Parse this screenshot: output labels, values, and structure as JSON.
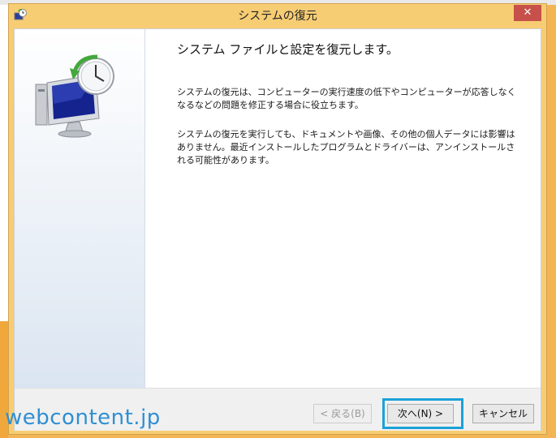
{
  "window": {
    "title": "システムの復元",
    "close_label": "✕"
  },
  "content": {
    "heading": "システム ファイルと設定を復元します。",
    "paragraph1": "システムの復元は、コンピューターの実行速度の低下やコンピューターが応答しなくなるなどの問題を修正する場合に役立ちます。",
    "paragraph2": "システムの復元を実行しても、ドキュメントや画像、その他の個人データには影響はありません。最近インストールしたプログラムとドライバーは、アンインストールされる可能性があります。"
  },
  "buttons": {
    "back": "< 戻る(B)",
    "next": "次へ(N) >",
    "cancel": "キャンセル"
  },
  "watermark": "webcontent.jp",
  "icons": {
    "title": "system-restore-icon",
    "illustration": "monitor-clock-restore-icon"
  },
  "colors": {
    "desktop": "#f3b454",
    "window_frame": "#f7cd74",
    "close_button": "#c7504a",
    "highlight": "#1ba1d8",
    "watermark": "#2f8fd2"
  }
}
